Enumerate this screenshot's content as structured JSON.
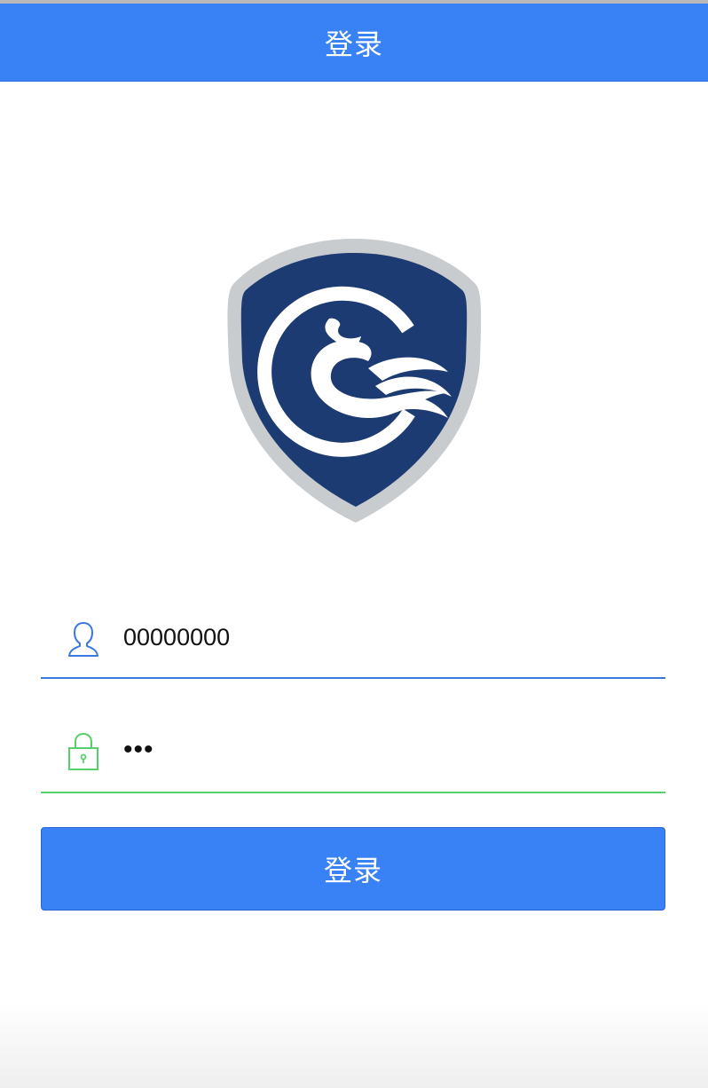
{
  "header": {
    "title": "登录"
  },
  "logo": {
    "icon": "shield-phoenix-logo",
    "colors": {
      "shield": "#1d3b73",
      "border": "#c9cccf",
      "emblem": "#ffffff"
    }
  },
  "form": {
    "username": {
      "icon": "user-icon",
      "value": "00000000",
      "underline_color": "#3a78e0"
    },
    "password": {
      "icon": "lock-icon",
      "value": "•••",
      "underline_color": "#56d06a"
    },
    "submit_label": "登录"
  },
  "theme": {
    "primary": "#3982f5"
  }
}
